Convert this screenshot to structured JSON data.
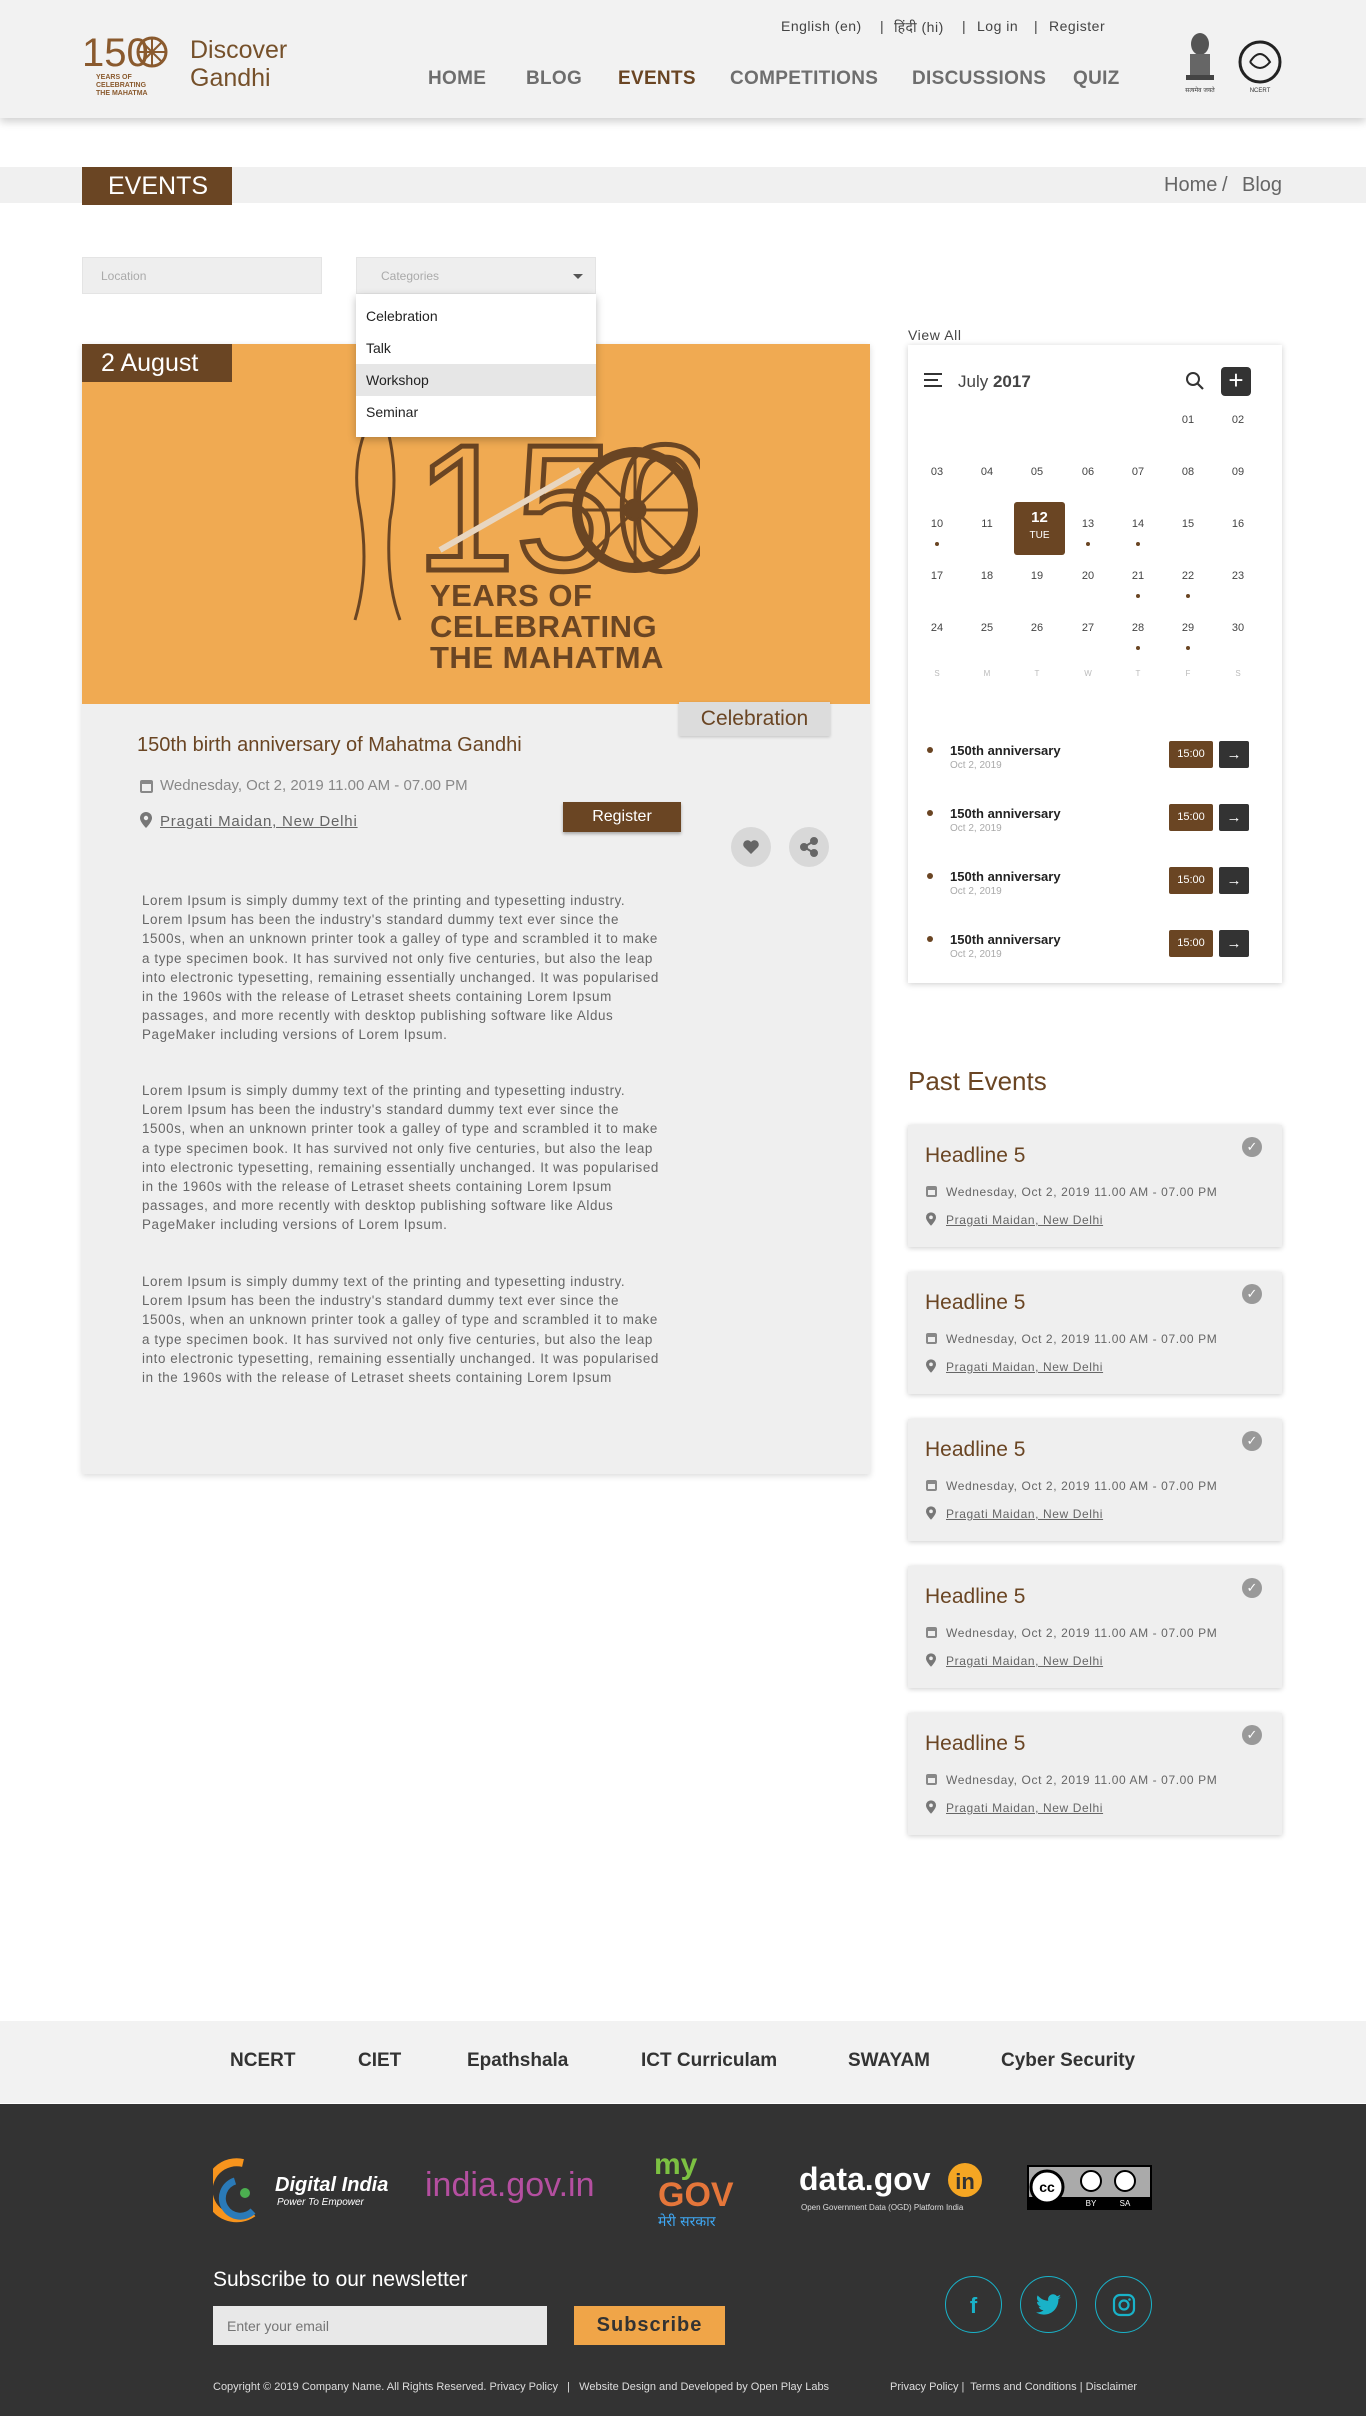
{
  "header": {
    "brand_line1": "Discover",
    "brand_line2": "Gandhi",
    "logo_number": "150",
    "logo_text": "YEARS OF CELEBRATING THE MAHATMA",
    "top_links": [
      "English (en)",
      "हिंदी (hi)",
      "Log in",
      "Register"
    ],
    "nav": [
      "HOME",
      "BLOG",
      "EVENTS",
      "COMPETITIONS",
      "DISCUSSIONS",
      "QUIZ"
    ],
    "active_nav": "EVENTS",
    "emblem_caption": "सत्यमेव जयते",
    "ncert_caption": "NCERT"
  },
  "page": {
    "title": "EVENTS",
    "breadcrumb": [
      "Home",
      "Blog"
    ]
  },
  "filters": {
    "location_placeholder": "Location",
    "categories_placeholder": "Categories",
    "options": [
      "Celebration",
      "Talk",
      "Workshop",
      "Seminar"
    ],
    "highlighted_option": "Workshop"
  },
  "event": {
    "date_tag": "2 August",
    "hero_number": "150",
    "hero_text": [
      "YEARS OF",
      "CELEBRATING",
      "THE MAHATMA"
    ],
    "category": "Celebration",
    "title": "150th birth anniversary of Mahatma Gandhi",
    "datetime": "Wednesday, Oct 2, 2019 11.00 AM - 07.00 PM",
    "location": "Pragati Maidan, New Delhi",
    "register_label": "Register",
    "paragraphs": [
      "Lorem Ipsum is simply dummy text of the printing and typesetting industry. Lorem Ipsum has been the industry's standard dummy text ever since the 1500s, when an unknown printer took a galley of type and scrambled it to make a type specimen book. It has survived not only five centuries, but also the leap into electronic typesetting, remaining essentially unchanged. It was popularised in the 1960s with the release of Letraset sheets containing Lorem Ipsum passages, and more recently with desktop publishing software like Aldus PageMaker including versions of Lorem Ipsum.",
      "Lorem Ipsum is simply dummy text of the printing and typesetting industry. Lorem Ipsum has been the industry's standard dummy text ever since the 1500s, when an unknown printer took a galley of type and scrambled it to make a type specimen book. It has survived not only five centuries, but also the leap into electronic typesetting, remaining essentially unchanged. It was popularised in the 1960s with the release of Letraset sheets containing Lorem Ipsum passages, and more recently with desktop publishing software like Aldus PageMaker including versions of Lorem Ipsum.",
      "Lorem Ipsum is simply dummy text of the printing and typesetting industry. Lorem Ipsum has been the industry's standard dummy text ever since the 1500s, when an unknown printer took a galley of type and scrambled it to make a type specimen book. It has survived not only five centuries, but also the leap into electronic typesetting, remaining essentially unchanged. It was popularised in the 1960s with the release of Letraset sheets containing Lorem Ipsum"
    ]
  },
  "calendar": {
    "view_all": "View All",
    "month": "July",
    "year": "2017",
    "weeks": [
      [
        "",
        "",
        "",
        "",
        "",
        "01",
        "02"
      ],
      [
        "03",
        "04",
        "05",
        "06",
        "07",
        "08",
        "09"
      ],
      [
        "10",
        "11",
        "12",
        "13",
        "14",
        "15",
        "16"
      ],
      [
        "17",
        "18",
        "19",
        "20",
        "21",
        "22",
        "23"
      ],
      [
        "24",
        "25",
        "26",
        "27",
        "28",
        "29",
        "30"
      ]
    ],
    "event_days": [
      "10",
      "13",
      "14",
      "21",
      "22",
      "28",
      "29"
    ],
    "today_day": "12",
    "today_weekday": "TUE",
    "weekday_letters": [
      "S",
      "M",
      "T",
      "W",
      "T",
      "F",
      "S"
    ],
    "agenda": [
      {
        "title": "150th anniversary",
        "date": "Oct 2, 2019",
        "time": "15:00"
      },
      {
        "title": "150th anniversary",
        "date": "Oct 2, 2019",
        "time": "15:00"
      },
      {
        "title": "150th anniversary",
        "date": "Oct 2, 2019",
        "time": "15:00"
      },
      {
        "title": "150th anniversary",
        "date": "Oct 2, 2019",
        "time": "15:00"
      }
    ]
  },
  "past_events": {
    "heading": "Past Events",
    "items": [
      {
        "title": "Headline 5",
        "datetime": "Wednesday, Oct 2, 2019 11.00 AM - 07.00 PM",
        "location": "Pragati Maidan, New Delhi"
      },
      {
        "title": "Headline 5",
        "datetime": "Wednesday, Oct 2, 2019 11.00 AM - 07.00 PM",
        "location": "Pragati Maidan, New Delhi"
      },
      {
        "title": "Headline 5",
        "datetime": "Wednesday, Oct 2, 2019 11.00 AM - 07.00 PM",
        "location": "Pragati Maidan, New Delhi"
      },
      {
        "title": "Headline 5",
        "datetime": "Wednesday, Oct 2, 2019 11.00 AM - 07.00 PM",
        "location": "Pragati Maidan, New Delhi"
      },
      {
        "title": "Headline 5",
        "datetime": "Wednesday, Oct 2, 2019 11.00 AM - 07.00 PM",
        "location": "Pragati Maidan, New Delhi"
      }
    ]
  },
  "footer": {
    "links": [
      "NCERT",
      "CIET",
      "Epathshala",
      "ICT Curriculam",
      "SWAYAM",
      "Cyber Security"
    ],
    "partners": {
      "digital_india": "Digital India",
      "digital_india_tag": "Power To Empower",
      "india_gov": "india.gov.in",
      "mygov_1": "my",
      "mygov_2": "GOV",
      "mygov_hindi": "मेरी सरकार",
      "data_gov": "data.gov",
      "data_gov_in": "in",
      "data_gov_tag": "Open Government Data (OGD) Platform India",
      "cc_by": "BY",
      "cc_sa": "SA"
    },
    "newsletter_heading": "Subscribe to our newsletter",
    "email_placeholder": "Enter your email",
    "subscribe_label": "Subscribe",
    "social": [
      "f",
      "t",
      "i"
    ],
    "copyright": "Copyright © 2019 Company Name. All Rights Reserved. Privacy Policy   |   Website Design and Developed by Open Play Labs",
    "legal": "Privacy Policy |  Terms and Conditions | Disclaimer"
  },
  "colors": {
    "brand_brown": "#6a4523",
    "hero_orange": "#f0aa52",
    "footer_dark": "#333333",
    "social_teal": "#19b2c8",
    "subscribe_orange": "#f0a548"
  }
}
